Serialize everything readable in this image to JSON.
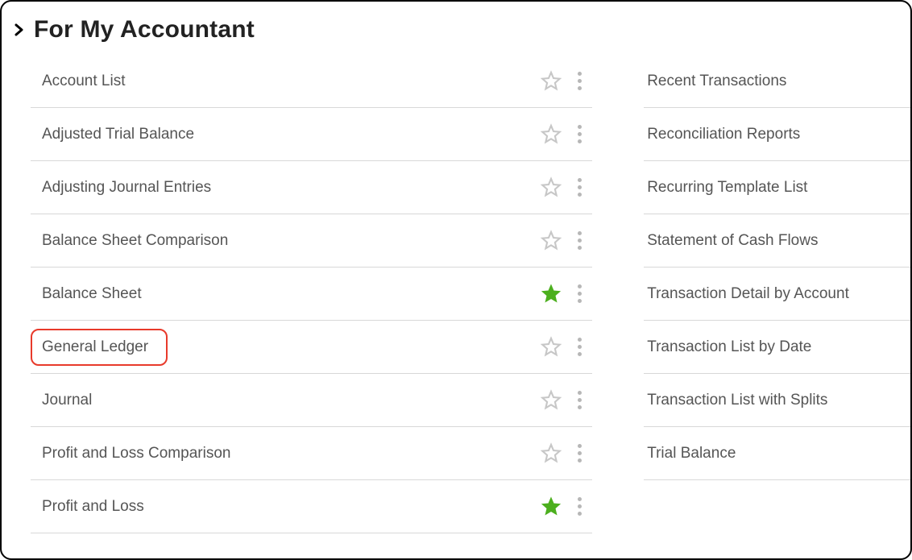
{
  "section": {
    "title": "For My Accountant"
  },
  "left_items": [
    {
      "label": "Account List",
      "favorite": false,
      "highlighted": false
    },
    {
      "label": "Adjusted Trial Balance",
      "favorite": false,
      "highlighted": false
    },
    {
      "label": "Adjusting Journal Entries",
      "favorite": false,
      "highlighted": false
    },
    {
      "label": "Balance Sheet Comparison",
      "favorite": false,
      "highlighted": false
    },
    {
      "label": "Balance Sheet",
      "favorite": true,
      "highlighted": false
    },
    {
      "label": "General Ledger",
      "favorite": false,
      "highlighted": true
    },
    {
      "label": "Journal",
      "favorite": false,
      "highlighted": false
    },
    {
      "label": "Profit and Loss Comparison",
      "favorite": false,
      "highlighted": false
    },
    {
      "label": "Profit and Loss",
      "favorite": true,
      "highlighted": false
    }
  ],
  "right_items": [
    {
      "label": "Recent Transactions"
    },
    {
      "label": "Reconciliation Reports"
    },
    {
      "label": "Recurring Template List"
    },
    {
      "label": "Statement of Cash Flows"
    },
    {
      "label": "Transaction Detail by Account"
    },
    {
      "label": "Transaction List by Date"
    },
    {
      "label": "Transaction List with Splits"
    },
    {
      "label": "Trial Balance"
    }
  ]
}
